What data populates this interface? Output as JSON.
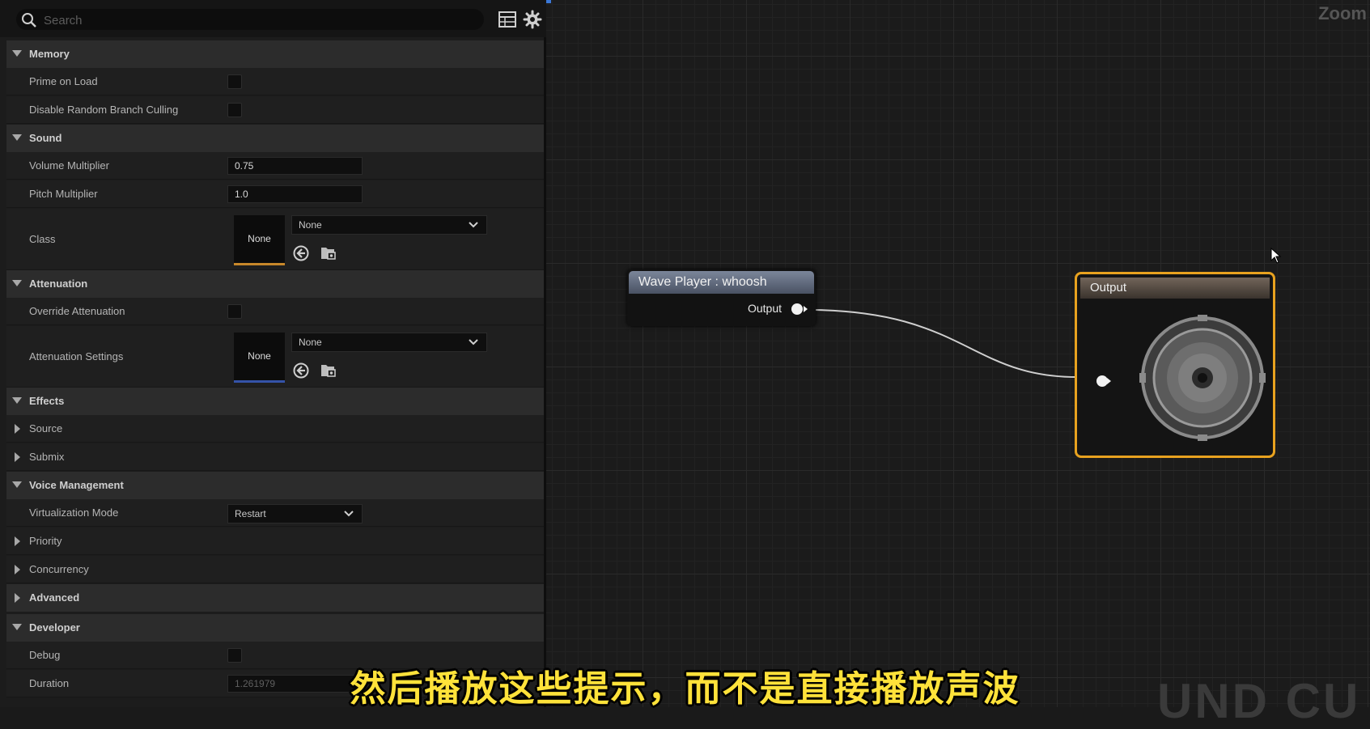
{
  "search": {
    "placeholder": "Search"
  },
  "sections": {
    "memory": {
      "title": "Memory",
      "prime_on_load": "Prime on Load",
      "disable_random_branch_culling": "Disable Random Branch Culling"
    },
    "sound": {
      "title": "Sound",
      "volume_multiplier": {
        "label": "Volume Multiplier",
        "value": "0.75"
      },
      "pitch_multiplier": {
        "label": "Pitch Multiplier",
        "value": "1.0"
      },
      "class": {
        "label": "Class",
        "thumb": "None",
        "value": "None"
      }
    },
    "attenuation": {
      "title": "Attenuation",
      "override_attenuation": "Override Attenuation",
      "attenuation_settings": {
        "label": "Attenuation Settings",
        "thumb": "None",
        "value": "None"
      }
    },
    "effects": {
      "title": "Effects",
      "source": "Source",
      "submix": "Submix"
    },
    "voice_management": {
      "title": "Voice Management",
      "virtualization_mode": {
        "label": "Virtualization Mode",
        "value": "Restart"
      },
      "priority": "Priority",
      "concurrency": "Concurrency"
    },
    "advanced": {
      "title": "Advanced"
    },
    "developer": {
      "title": "Developer",
      "debug": "Debug",
      "duration": {
        "label": "Duration",
        "value": "1.261979"
      }
    }
  },
  "graph": {
    "zoom_label": "Zoom",
    "wave_node": {
      "title": "Wave Player : whoosh",
      "output_label": "Output"
    },
    "output_node": {
      "title": "Output"
    }
  },
  "subtitle": "然后播放这些提示，而不是直接播放声波",
  "watermark": "UND CU",
  "colors": {
    "output_border": "#e8a21f",
    "class_underline": "#c8882a",
    "attenuation_underline": "#3553a8",
    "subtitle": "#ffe23a"
  }
}
